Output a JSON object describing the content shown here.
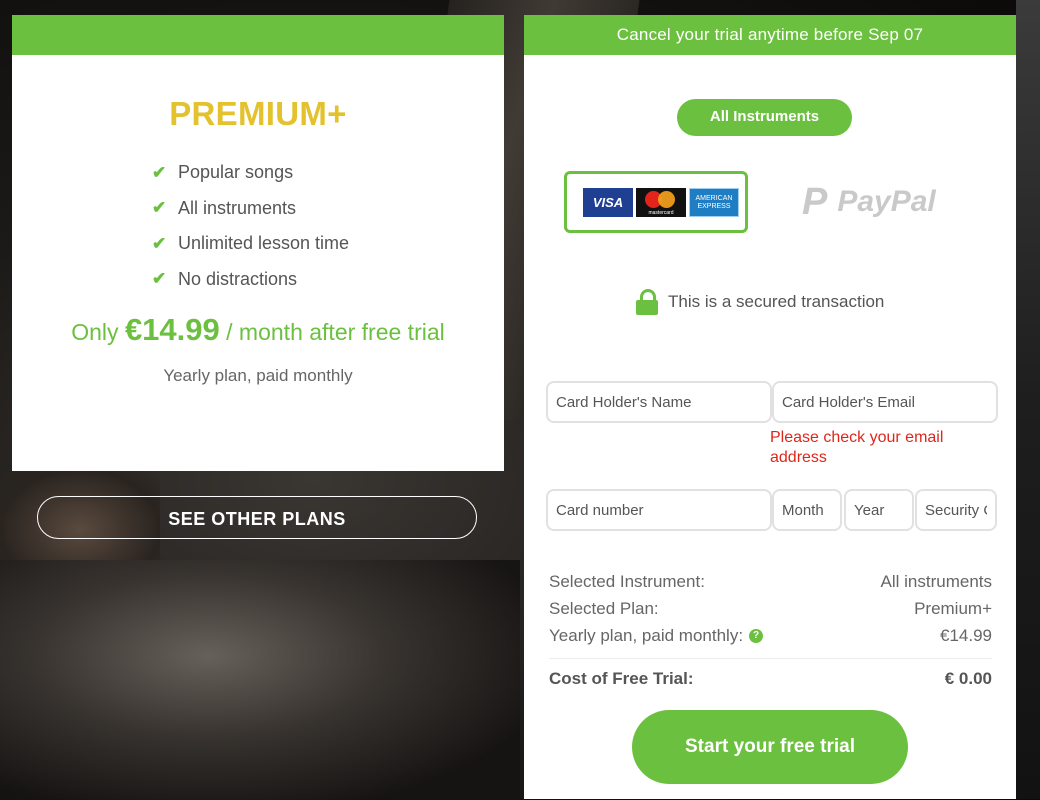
{
  "plan": {
    "name": "PREMIUM+",
    "features": [
      "Popular songs",
      "All instruments",
      "Unlimited lesson time",
      "No distractions"
    ],
    "price_prefix": "Only",
    "price": "€14.99",
    "price_suffix": "/ month after free trial",
    "billing_note": "Yearly plan, paid monthly"
  },
  "other_plans_label": "SEE OTHER PLANS",
  "checkout": {
    "banner": "Cancel your trial anytime before Sep 07",
    "instrument_pill": "All Instruments",
    "card_logos": {
      "visa": "VISA",
      "mastercard": "mastercard",
      "amex": "AMERICAN EXPRESS"
    },
    "paypal_label": "PayPal",
    "secure_text": "This is a secured transaction",
    "fields": {
      "holder_name": "Card Holder's Name",
      "holder_email": "Card Holder's Email",
      "card_number": "Card number",
      "month": "Month",
      "year": "Year",
      "security_code": "Security Code"
    },
    "email_error": "Please check your email address",
    "summary": [
      {
        "label": "Selected Instrument:",
        "value": "All instruments"
      },
      {
        "label": "Selected Plan:",
        "value": "Premium+"
      },
      {
        "label": "Yearly plan, paid monthly:",
        "value": "€14.99"
      }
    ],
    "total": {
      "label": "Cost of Free Trial:",
      "value": "€ 0.00"
    },
    "start_button": "Start your free trial"
  },
  "colors": {
    "accent": "#6cc040",
    "plan_name": "#e3c22e",
    "error": "#e0261b"
  }
}
